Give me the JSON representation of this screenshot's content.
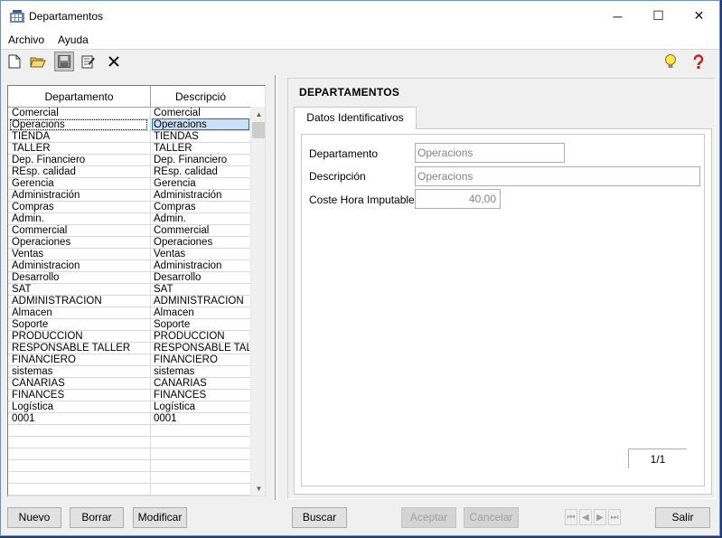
{
  "window": {
    "title": "Departamentos",
    "controls": {
      "minimize": "─",
      "maximize": "☐",
      "close": "✕"
    }
  },
  "menu": [
    "Archivo",
    "Ayuda"
  ],
  "toolbar": {
    "icons": [
      "new-document-icon",
      "open-folder-icon",
      "save-icon",
      "edit-icon",
      "delete-icon",
      "lightbulb-icon",
      "help-icon"
    ]
  },
  "list": {
    "columns": [
      "Departamento",
      "Descripció"
    ],
    "rows": [
      [
        "Comercial",
        "Comercial"
      ],
      [
        "Operacions",
        "Operacions"
      ],
      [
        "TIENDA",
        "TIENDAS"
      ],
      [
        "TALLER",
        "TALLER"
      ],
      [
        "Dep. Financiero",
        "Dep. Financiero"
      ],
      [
        "REsp. calidad",
        "REsp. calidad"
      ],
      [
        "Gerencia",
        "Gerencia"
      ],
      [
        "Administración",
        "Administración"
      ],
      [
        "Compras",
        "Compras"
      ],
      [
        "Admin.",
        "Admin."
      ],
      [
        "Commercial",
        "Commercial"
      ],
      [
        "Operaciones",
        "Operaciones"
      ],
      [
        "Ventas",
        "Ventas"
      ],
      [
        "Administracion",
        "Administracion"
      ],
      [
        "Desarrollo",
        "Desarrollo"
      ],
      [
        "SAT",
        "SAT"
      ],
      [
        "ADMINISTRACION",
        "ADMINISTRACION"
      ],
      [
        "Almacen",
        "Almacen"
      ],
      [
        "Soporte",
        "Soporte"
      ],
      [
        "PRODUCCION",
        "PRODUCCION"
      ],
      [
        "RESPONSABLE TALLER",
        "RESPONSABLE TALL"
      ],
      [
        "FINANCIERO",
        "FINANCIERO"
      ],
      [
        "sistemas",
        "sistemas"
      ],
      [
        "CANARIAS",
        "CANARIAS"
      ],
      [
        "FINANCES",
        "FINANCES"
      ],
      [
        "Logística",
        "Logística"
      ],
      [
        "0001",
        "0001"
      ]
    ],
    "empty_rows": 6,
    "selected_index": 1
  },
  "detail": {
    "section_title": "DEPARTAMENTOS",
    "tab_label": "Datos Identificativos",
    "fields": {
      "departamento": {
        "label": "Departamento",
        "value": "Operacions"
      },
      "descripcion": {
        "label": "Descripción",
        "value": "Operacions"
      },
      "coste": {
        "label": "Coste Hora Imputable",
        "value": "40,00"
      }
    },
    "pager": "1/1"
  },
  "buttons": {
    "nuevo": "Nuevo",
    "borrar": "Borrar",
    "modificar": "Modificar",
    "buscar": "Buscar",
    "aceptar": "Aceptar",
    "cancelar": "Cancelar",
    "salir": "Salir"
  },
  "nav": {
    "first": "⏮",
    "prev": "◀",
    "next": "▶",
    "last": "⏭"
  }
}
